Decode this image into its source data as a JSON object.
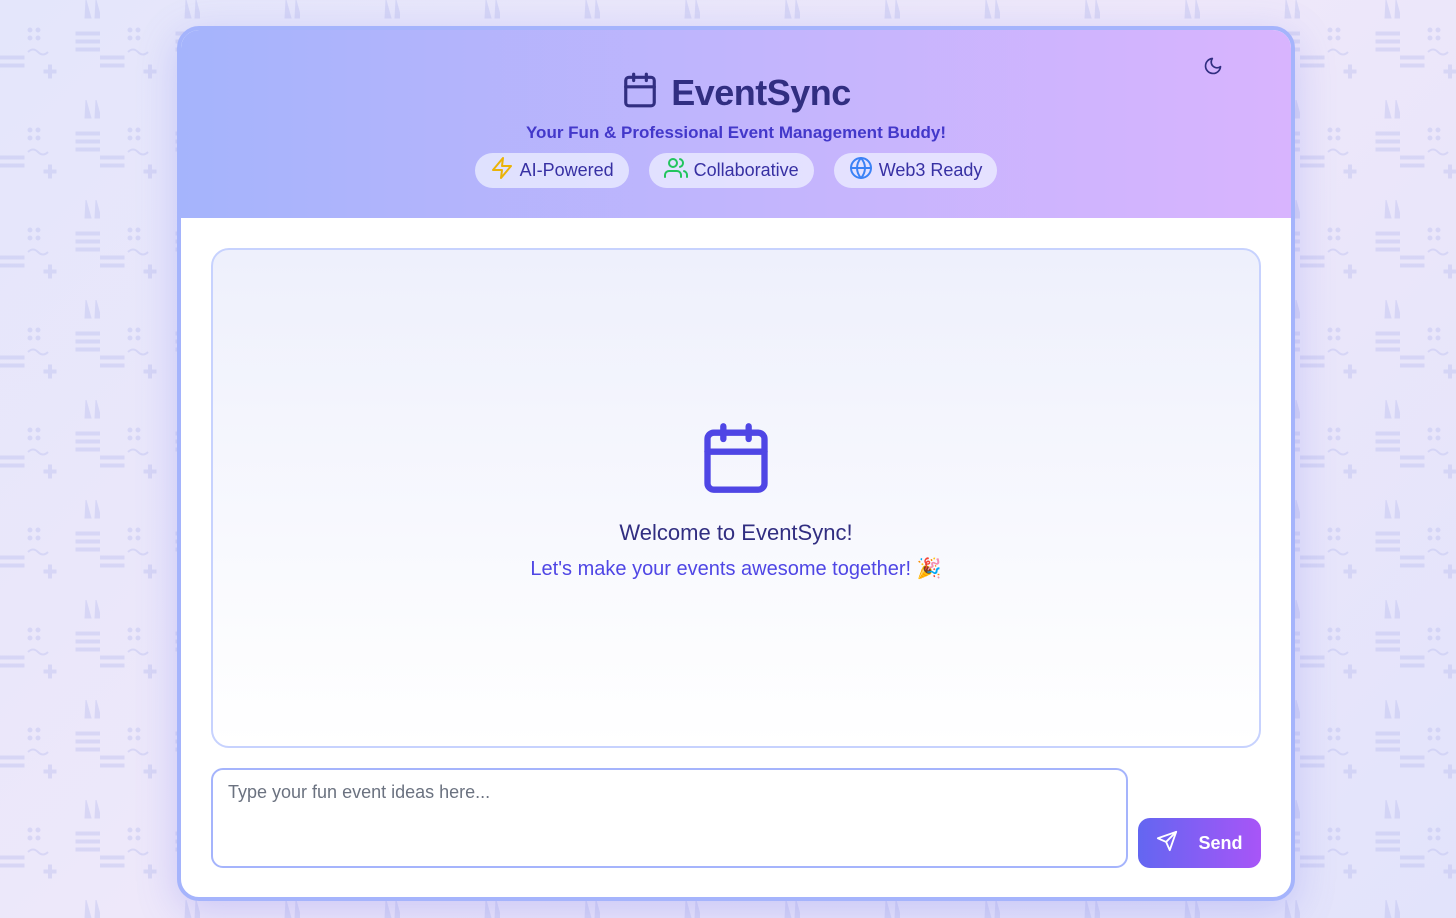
{
  "app": {
    "title": "EventSync",
    "tagline": "Your Fun & Professional Event Management Buddy!",
    "logo_icon": "calendar-icon",
    "theme_toggle_icon": "moon-icon"
  },
  "features": [
    {
      "label": "AI-Powered",
      "icon": "lightning-icon",
      "color": "#eab308"
    },
    {
      "label": "Collaborative",
      "icon": "users-icon",
      "color": "#22c55e"
    },
    {
      "label": "Web3 Ready",
      "icon": "globe-icon",
      "color": "#3b82f6"
    }
  ],
  "welcome": {
    "icon": "calendar-icon",
    "title": "Welcome to EventSync!",
    "subtitle": "Let's make your events awesome together! 🎉"
  },
  "composer": {
    "placeholder": "Type your fun event ideas here...",
    "value": "",
    "send_label": "Send",
    "send_icon": "send-icon"
  },
  "colors": {
    "primary": "#4f46e5",
    "dark_text": "#312e81",
    "header_gradient_start": "#a5b4fc",
    "header_gradient_end": "#d8b4fe",
    "send_gradient_start": "#6366f1",
    "send_gradient_end": "#a855f7"
  }
}
